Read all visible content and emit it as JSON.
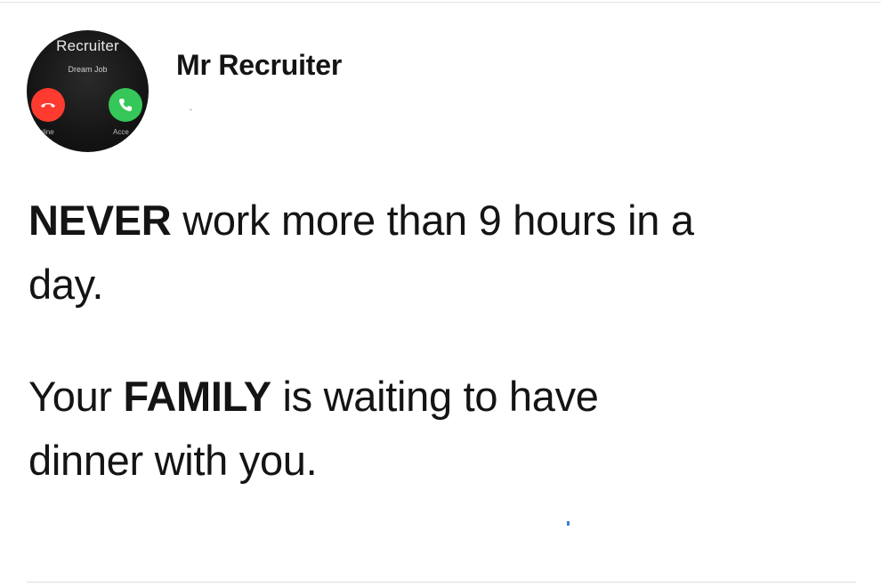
{
  "profile": {
    "avatar": {
      "title": "Recruiter",
      "subtitle": "Dream Job",
      "decline_label": "Decline",
      "accept_label": "Acce",
      "decline_color": "#ff3b30",
      "accept_color": "#35c759",
      "decline_icon": "phone-hangup-icon",
      "accept_icon": "phone-icon"
    },
    "name": "Mr Recruiter"
  },
  "tweet": {
    "line1_bold": "NEVER",
    "line1_rest": " work more than 9 hours in a",
    "line2": "day.",
    "line3_pre": "Your ",
    "line3_bold": "FAMILY",
    "line3_rest": " is waiting to have",
    "line4": "dinner with you."
  }
}
